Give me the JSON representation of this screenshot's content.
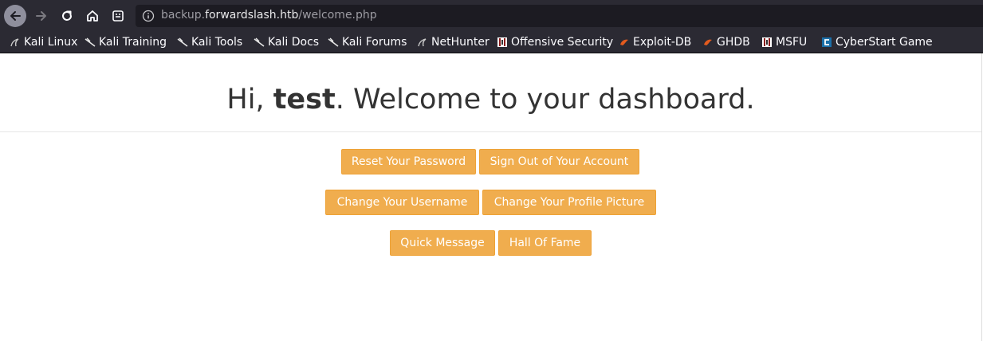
{
  "browser": {
    "url_prefix": "backup.",
    "url_host": "forwardslash.htb",
    "url_path": "/welcome.php",
    "icons": [
      "back-icon",
      "forward-icon",
      "reload-icon",
      "home-icon",
      "reader-icon",
      "info-icon"
    ]
  },
  "bookmarks": [
    {
      "label": "Kali Linux",
      "icon": "kali-dragon-icon"
    },
    {
      "label": "Kali Training",
      "icon": "kali-dragon-icon"
    },
    {
      "label": "Kali Tools",
      "icon": "kali-dragon-icon"
    },
    {
      "label": "Kali Docs",
      "icon": "kali-dragon-icon"
    },
    {
      "label": "Kali Forums",
      "icon": "kali-dragon-icon"
    },
    {
      "label": "NetHunter",
      "icon": "nethunter-icon"
    },
    {
      "label": "Offensive Security",
      "icon": "offsec-icon"
    },
    {
      "label": "Exploit-DB",
      "icon": "exploitdb-icon"
    },
    {
      "label": "GHDB",
      "icon": "ghdb-icon"
    },
    {
      "label": "MSFU",
      "icon": "offsec-icon"
    },
    {
      "label": "CyberStart Game",
      "icon": "cyberstart-icon"
    }
  ],
  "page": {
    "greeting": "Hi, ",
    "username": "test",
    "welcome": ". Welcome to your dashboard.",
    "buttons": [
      {
        "label": "Reset Your Password"
      },
      {
        "label": "Sign Out of Your Account"
      },
      {
        "label": "Change Your Username"
      },
      {
        "label": "Change Your Profile Picture"
      },
      {
        "label": "Quick Message"
      },
      {
        "label": "Hall Of Fame"
      }
    ]
  },
  "colors": {
    "button_bg": "#f0ad4e",
    "button_border": "#eea236",
    "chrome_bg": "#2b2a33",
    "urlbar_bg": "#1c1b22"
  }
}
